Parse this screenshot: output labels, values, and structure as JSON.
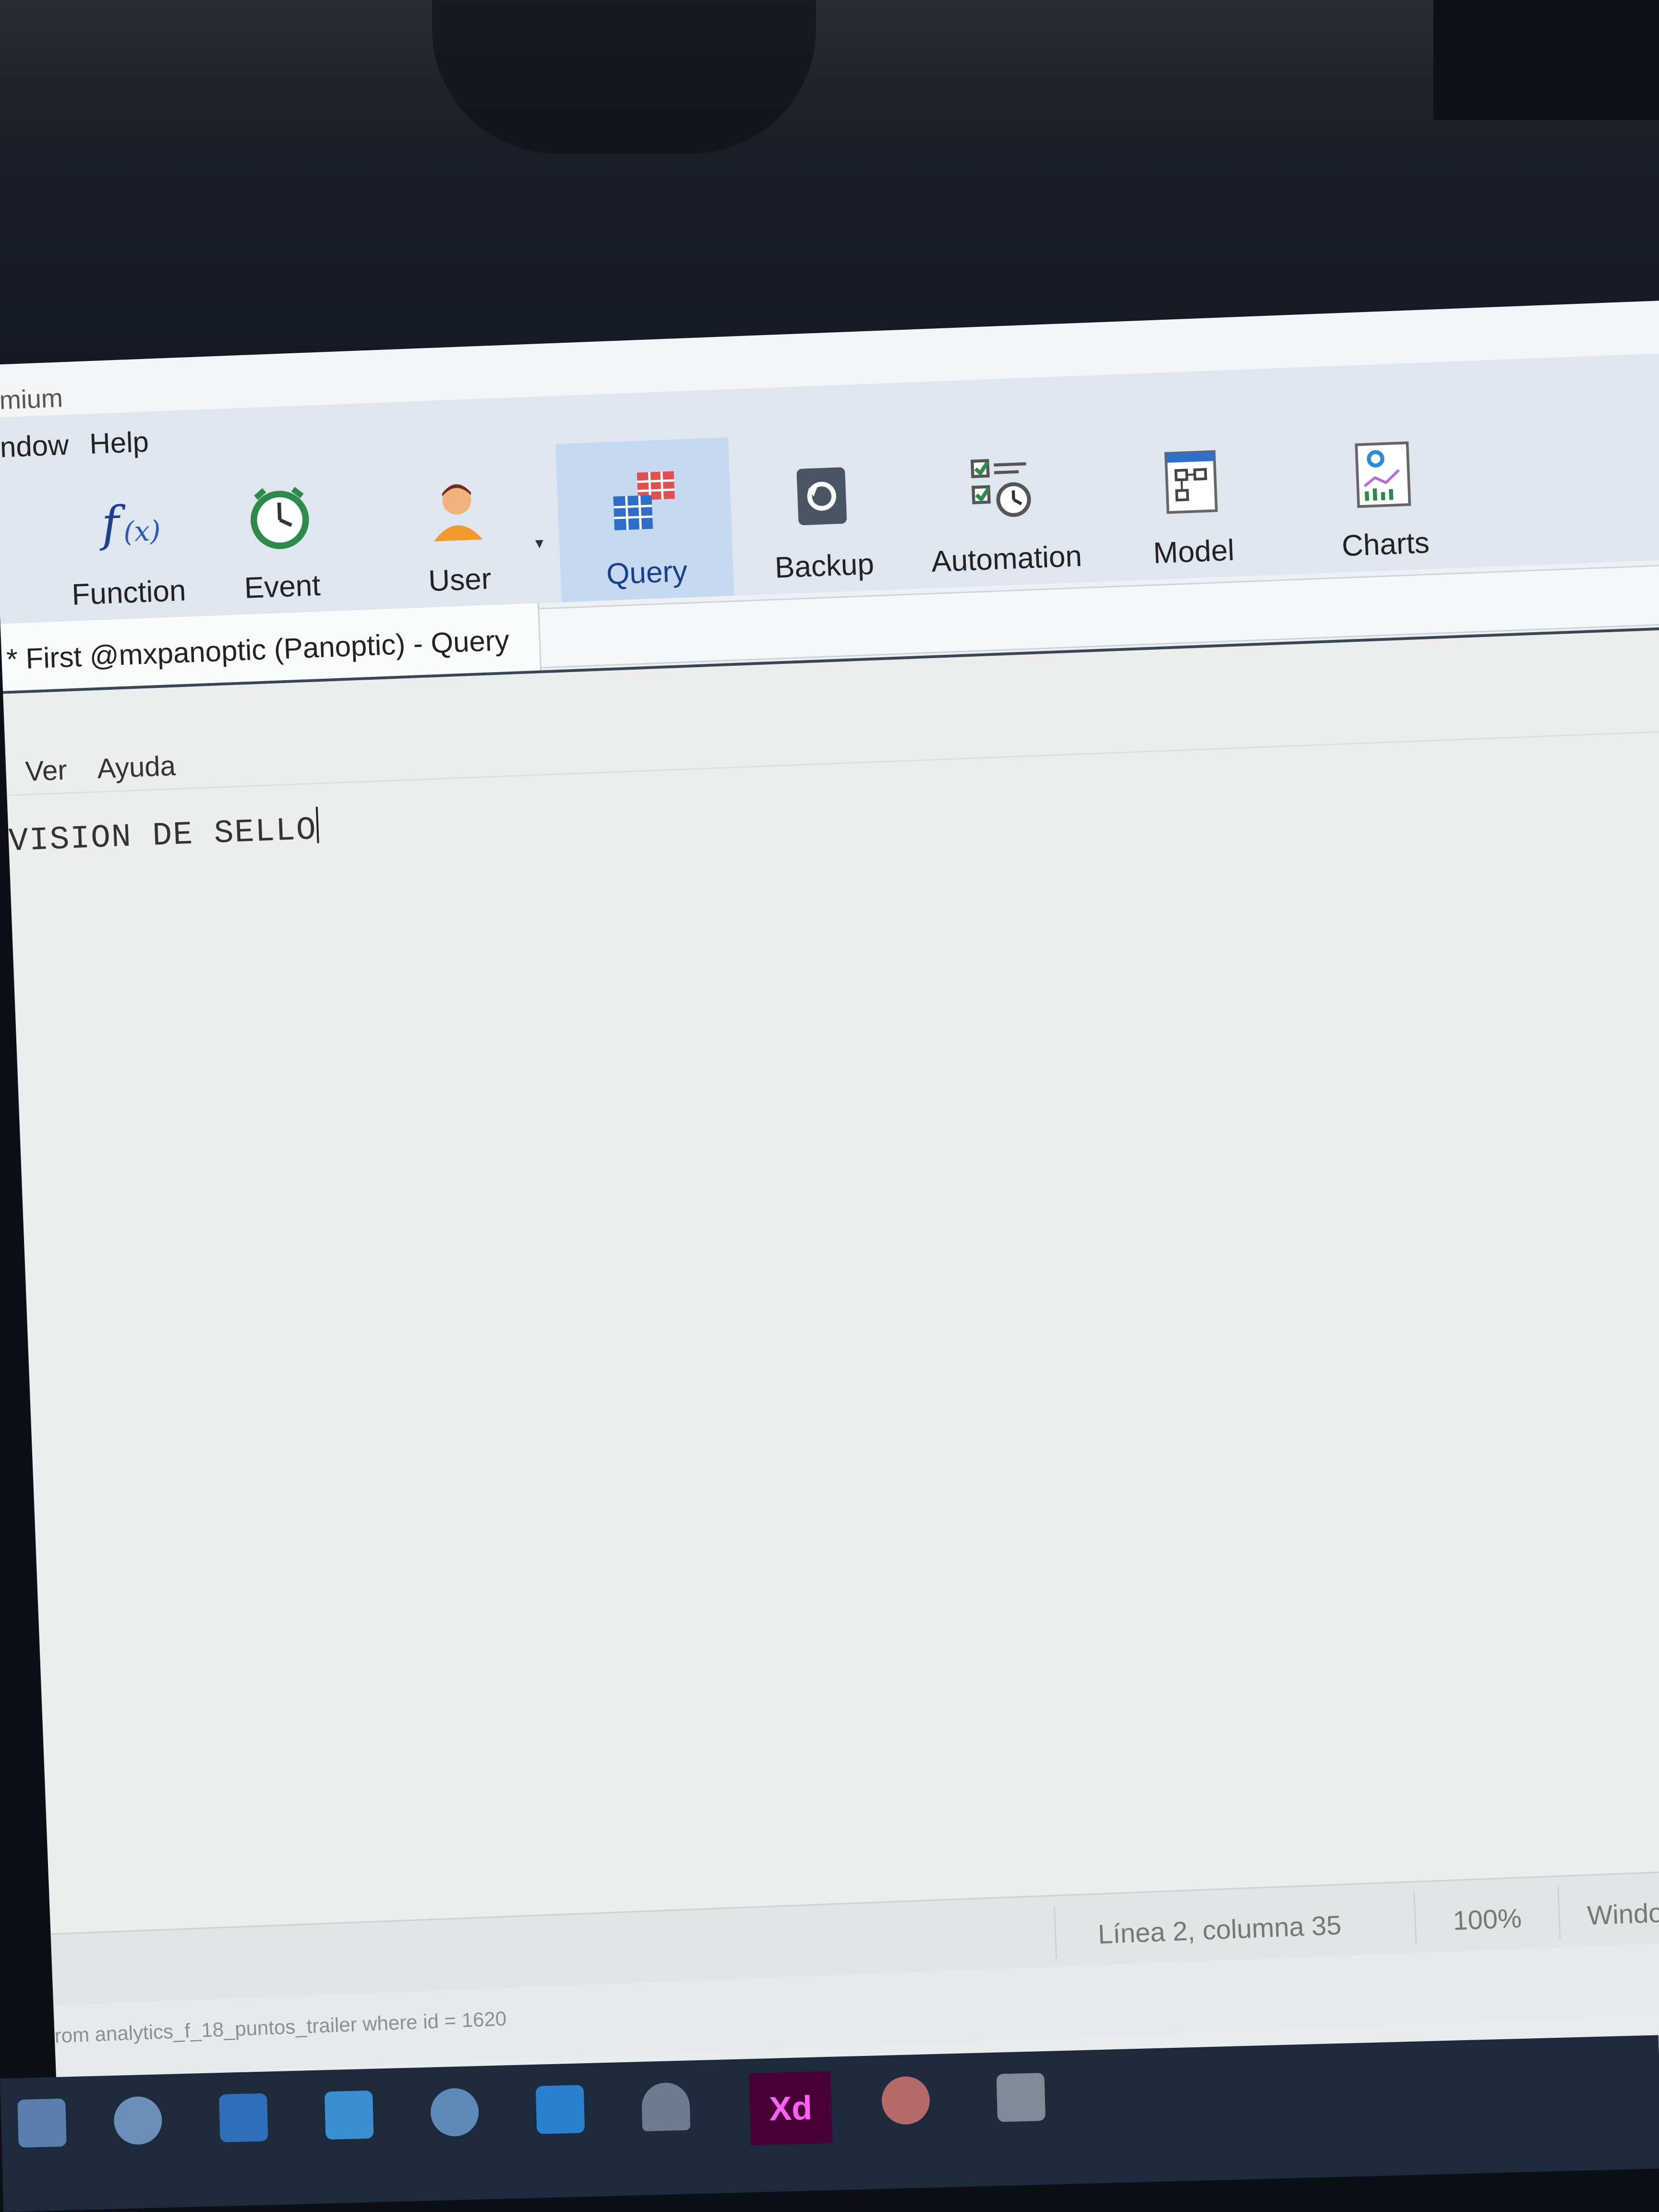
{
  "window": {
    "title_fragment": "mium"
  },
  "menubar": {
    "items": [
      "indow",
      "Help"
    ]
  },
  "ribbon": {
    "buttons": [
      {
        "label": "Function",
        "icon": "function-fx-icon"
      },
      {
        "label": "Event",
        "icon": "alarm-clock-icon"
      },
      {
        "label": "User",
        "icon": "user-icon"
      },
      {
        "label": "Query",
        "icon": "query-table-icon",
        "active": true
      },
      {
        "label": "Backup",
        "icon": "backup-restore-icon"
      },
      {
        "label": "Automation",
        "icon": "automation-checklist-icon"
      },
      {
        "label": "Model",
        "icon": "model-diagram-icon"
      },
      {
        "label": "Charts",
        "icon": "charts-icon"
      }
    ],
    "user_dropdown": "▾"
  },
  "tab": {
    "active_label": "* First @mxpanoptic (Panoptic) - Query"
  },
  "editor": {
    "menu": [
      "Ver",
      "Ayuda"
    ],
    "content": "VISION DE SELLO"
  },
  "statusbar": {
    "position": "Línea 2, columna 35",
    "zoom": "100%",
    "line_ending": "Windows"
  },
  "query_bar": {
    "text": "rom analytics_f_18_puntos_trailer where id = 1620"
  },
  "taskbar": {
    "icons": [
      "file-explorer-icon",
      "edge-browser-icon",
      "outlook-icon",
      "powershell-icon",
      "skype-icon",
      "vscode-icon",
      "cloud-icon",
      "adobe-xd-icon",
      "chrome-icon",
      "folder-icon"
    ],
    "xd_label": "Xd"
  },
  "colors": {
    "ribbon_bg": "#dfe6ef",
    "active_tab": "#c5daf1",
    "taskbar": "#1c2a3b"
  }
}
